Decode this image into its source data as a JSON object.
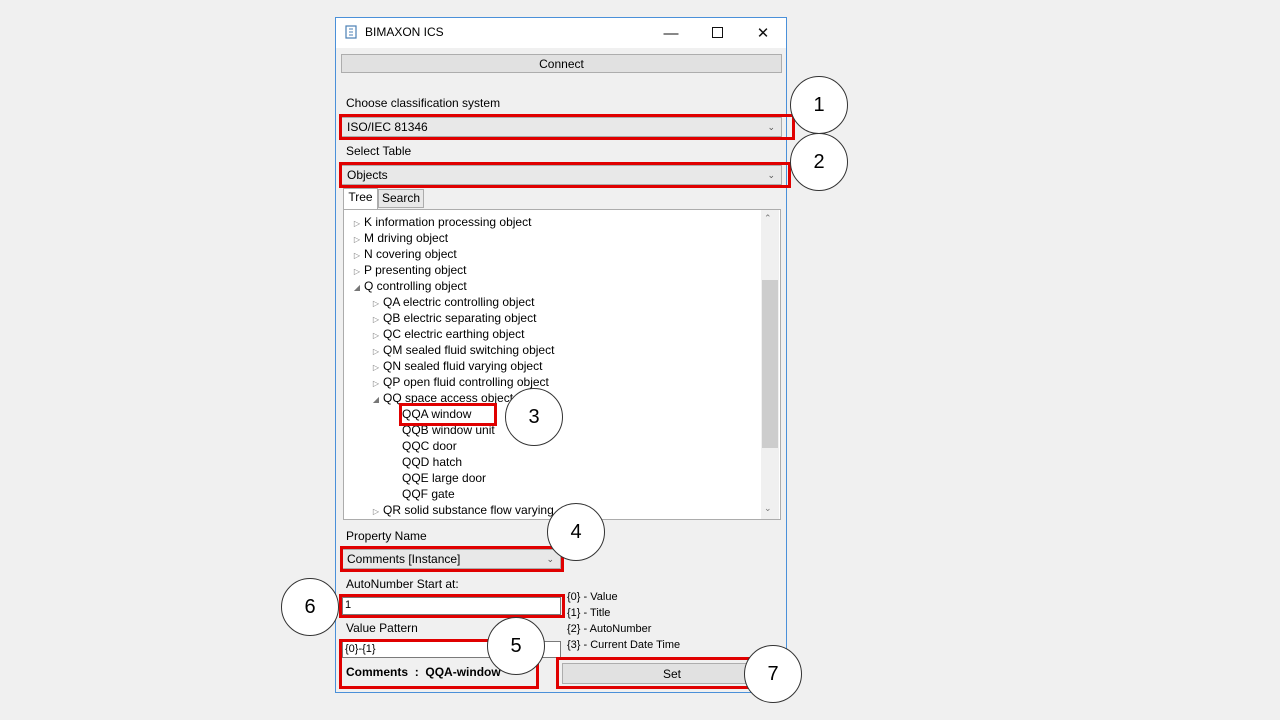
{
  "window": {
    "title": "BIMAXON ICS"
  },
  "connect_label": "Connect",
  "classification": {
    "label": "Choose classification system",
    "value": "ISO/IEC 81346"
  },
  "table": {
    "label": "Select Table",
    "value": "Objects"
  },
  "tabs": [
    "Tree",
    "Search"
  ],
  "tree": [
    {
      "text": "K information processing object",
      "expander": "collapsed"
    },
    {
      "text": "M driving object",
      "expander": "collapsed"
    },
    {
      "text": "N covering object",
      "expander": "collapsed"
    },
    {
      "text": "P presenting object",
      "expander": "collapsed"
    },
    {
      "text": "Q controlling object",
      "expander": "expanded"
    },
    {
      "text": "QA electric controlling object",
      "expander": "collapsed"
    },
    {
      "text": "QB electric separating object",
      "expander": "collapsed"
    },
    {
      "text": "QC electric earthing object",
      "expander": "collapsed"
    },
    {
      "text": "QM sealed fluid switching object",
      "expander": "collapsed"
    },
    {
      "text": "QN sealed fluid varying object",
      "expander": "collapsed"
    },
    {
      "text": "QP open fluid controlling object",
      "expander": "collapsed"
    },
    {
      "text": "QQ space access object",
      "expander": "expanded"
    },
    {
      "text": "QQA window",
      "expander": "none"
    },
    {
      "text": "QQB window unit",
      "expander": "none"
    },
    {
      "text": "QQC door",
      "expander": "none"
    },
    {
      "text": "QQD hatch",
      "expander": "none"
    },
    {
      "text": "QQE large door",
      "expander": "none"
    },
    {
      "text": "QQF gate",
      "expander": "none"
    },
    {
      "text": "QR solid substance flow varying",
      "expander": "collapsed"
    }
  ],
  "property": {
    "label": "Property Name",
    "value": "Comments [Instance]"
  },
  "autonumber": {
    "label": "AutoNumber Start at:",
    "value": "1"
  },
  "pattern": {
    "label": "Value Pattern",
    "value": "{0}-{1}"
  },
  "legend": [
    "{0} - Value",
    "{1} - Title",
    "{2} - AutoNumber",
    "{3} - Current Date Time"
  ],
  "preview": {
    "name": "Comments",
    "sep": ":",
    "value": "QQA-window"
  },
  "set_label": "Set",
  "callouts": [
    "1",
    "2",
    "3",
    "4",
    "5",
    "6",
    "7"
  ],
  "colors": {
    "highlight": "#e00000",
    "window_border": "#4a90d9"
  }
}
